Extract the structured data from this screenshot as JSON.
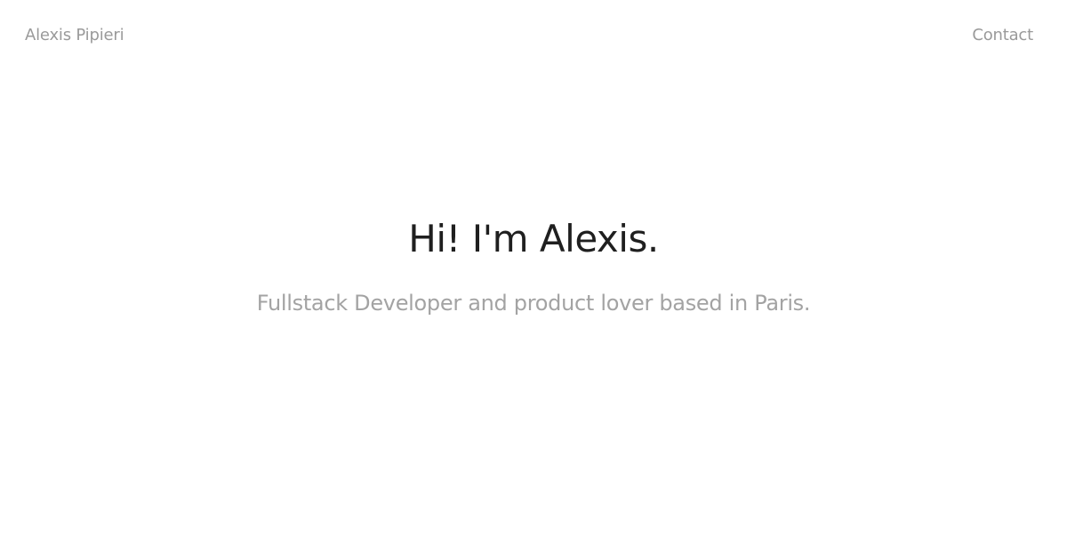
{
  "header": {
    "brand": "Alexis Pipieri",
    "nav": {
      "contact_label": "Contact"
    }
  },
  "hero": {
    "title": "Hi! I'm Alexis.",
    "subtitle": "Fullstack Developer and product lover based in Paris."
  },
  "colors": {
    "background": "#ffffff",
    "text_primary": "#1f1f1f",
    "text_muted": "#9a9a9a"
  }
}
